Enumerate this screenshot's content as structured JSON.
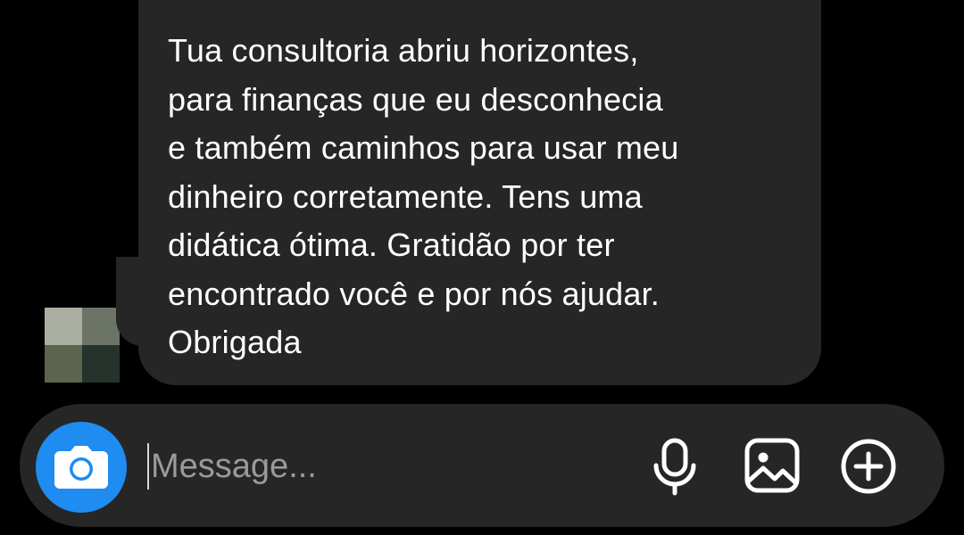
{
  "conversation": {
    "received_message": {
      "text": "Tua consultoria abriu horizontes,\npara finanças que eu desconhecia\ne também caminhos para usar meu\ndinheiro corretamente. Tens uma\ndidática ótima. Gratidão por ter\nencontrado você e por nós ajudar.\nObrigada",
      "bubble_color": "#262626"
    },
    "sender_avatar": "blurred-profile-photo"
  },
  "composer": {
    "placeholder": "Message...",
    "value": "",
    "camera_icon": "camera-icon",
    "camera_color": "#1e8cf0",
    "mic_icon": "microphone-icon",
    "gallery_icon": "image-gallery-icon",
    "more_icon": "plus-circle-icon"
  },
  "colors": {
    "background": "#000000",
    "surface": "#262626",
    "accent": "#1e8cf0",
    "text": "#ffffff",
    "placeholder": "#9a9a9a"
  }
}
